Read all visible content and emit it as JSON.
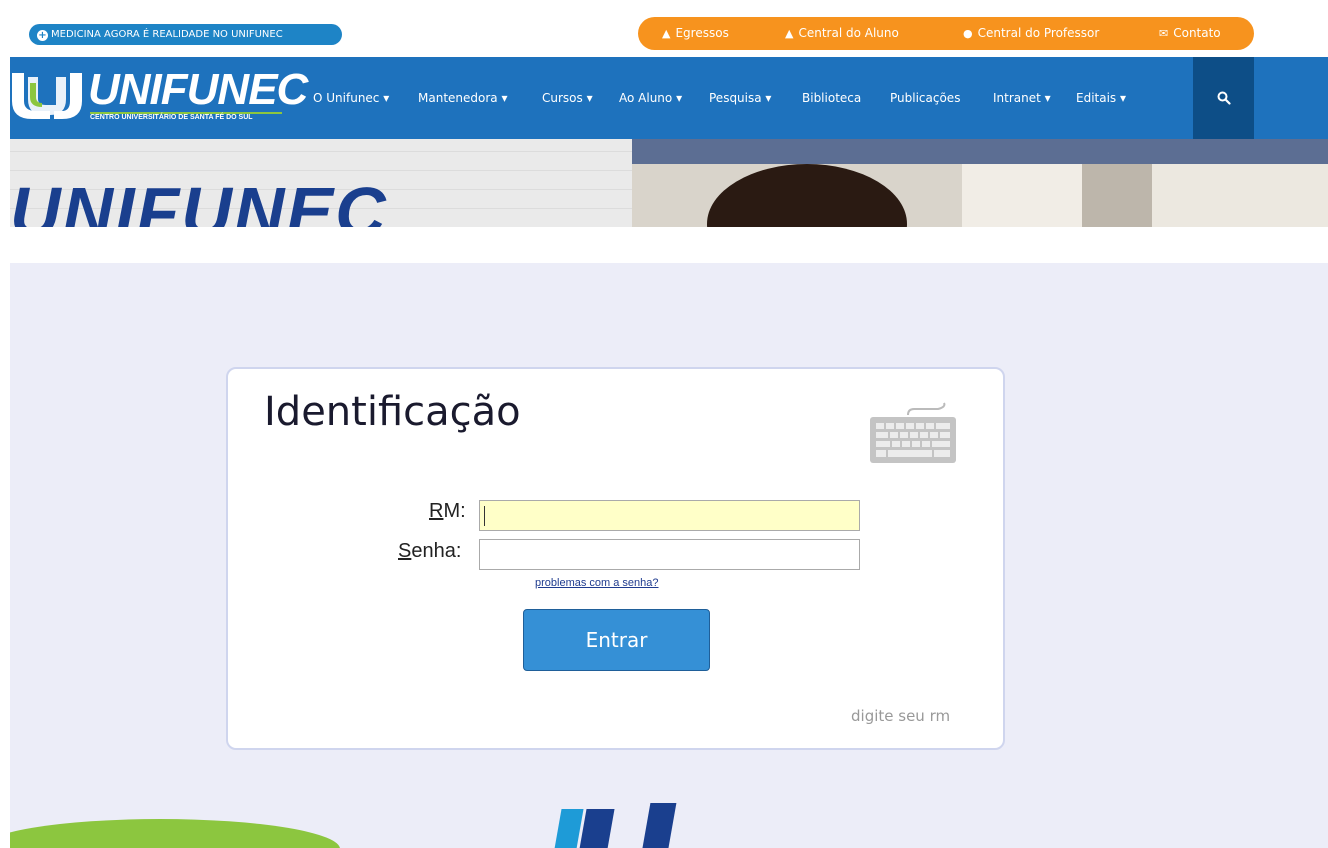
{
  "topbar": {
    "promo_label": "MEDICINA AGORA É REALIDADE NO UNIFUNEC",
    "links": [
      {
        "label": "Egressos",
        "icon": "graduation-cap-icon"
      },
      {
        "label": "Central do Aluno",
        "icon": "graduation-cap-icon"
      },
      {
        "label": "Central do Professor",
        "icon": "user-icon"
      },
      {
        "label": "Contato",
        "icon": "envelope-icon"
      }
    ],
    "colors": {
      "accent": "#f7931e",
      "promo": "#1e84c6"
    }
  },
  "navbar": {
    "logo_text": "UNIFUNEC",
    "logo_subtitle": "CENTRO UNIVERSITÁRIO DE SANTA FÉ DO SUL",
    "items": [
      {
        "label": "O Unifunec ▾"
      },
      {
        "label": "Mantenedora ▾"
      },
      {
        "label": "Cursos ▾"
      },
      {
        "label": "Ao Aluno ▾"
      },
      {
        "label": "Pesquisa ▾"
      },
      {
        "label": "Biblioteca"
      },
      {
        "label": "Publicações"
      },
      {
        "label": "Intranet ▾"
      },
      {
        "label": "Editais ▾"
      }
    ],
    "search_icon": "search-icon",
    "colors": {
      "bar": "#1e72bd",
      "search": "#0d4e87"
    }
  },
  "banner": {
    "word": "UNIFUNEC"
  },
  "login": {
    "title": "Identificação",
    "keyboard_icon": "keyboard-icon",
    "rm_label_accesskey": "R",
    "rm_label_rest": "M:",
    "rm_value": "",
    "password_label_accesskey": "S",
    "password_label_rest": "enha:",
    "password_value": "",
    "forgot_link": "problemas com a senha?",
    "submit_label": "Entrar",
    "hint": "digite seu rm"
  }
}
